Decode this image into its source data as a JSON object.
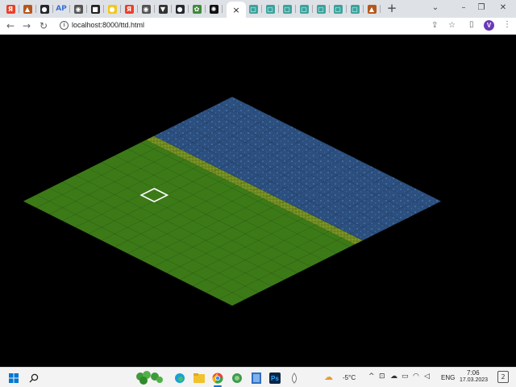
{
  "browser": {
    "tabs": [
      {
        "icon": "yandex-icon",
        "glyph": "Я",
        "color": "#e8402a"
      },
      {
        "icon": "game-castle-icon",
        "glyph": "▲",
        "color": "#b5571b"
      },
      {
        "icon": "github-icon",
        "glyph": "●",
        "color": "#24292e"
      },
      {
        "icon": "ap-icon",
        "glyph": "AP",
        "color": "#3b6fd4"
      },
      {
        "icon": "globe-icon",
        "glyph": "◉",
        "color": "#555555"
      },
      {
        "icon": "terminal-icon",
        "glyph": "■",
        "color": "#222222"
      },
      {
        "icon": "yellow-app-icon",
        "glyph": "●",
        "color": "#f2c81c"
      },
      {
        "icon": "yandex-icon",
        "glyph": "Я",
        "color": "#e8402a"
      },
      {
        "icon": "globe-icon",
        "glyph": "◉",
        "color": "#555555"
      },
      {
        "icon": "graduation-cap-icon",
        "glyph": "▼",
        "color": "#333333"
      },
      {
        "icon": "github-icon",
        "glyph": "●",
        "color": "#24292e"
      },
      {
        "icon": "green-app-icon",
        "glyph": "✿",
        "color": "#3f8a3a"
      },
      {
        "icon": "chatgpt-icon",
        "glyph": "✺",
        "color": "#111111"
      },
      {
        "icon": "page-icon",
        "glyph": "▢",
        "color": "#3aa39c"
      },
      {
        "icon": "page-icon",
        "glyph": "▢",
        "color": "#3aa39c"
      },
      {
        "icon": "page-icon",
        "glyph": "▢",
        "color": "#3aa39c"
      },
      {
        "icon": "page-icon",
        "glyph": "▢",
        "color": "#3aa39c"
      },
      {
        "icon": "page-icon",
        "glyph": "▢",
        "color": "#3aa39c"
      },
      {
        "icon": "page-icon",
        "glyph": "▢",
        "color": "#3aa39c"
      },
      {
        "icon": "page-icon",
        "glyph": "▢",
        "color": "#3aa39c"
      },
      {
        "icon": "game-castle-icon",
        "glyph": "▲",
        "color": "#b5571b"
      }
    ],
    "active_tab_close": "×",
    "new_tab": "+",
    "window_controls": {
      "dropdown": "⌄",
      "minimize": "–",
      "restore": "❐",
      "close": "✕"
    },
    "address": {
      "url": "localhost:8000/ttd.html",
      "info": "i"
    },
    "nav": {
      "back": "←",
      "forward": "→",
      "reload": "↻"
    },
    "omni_icons": {
      "share": "⇪",
      "bookmark": "☆",
      "sidebar": "▯"
    },
    "profile_initial": "V",
    "menu": "⋮"
  },
  "game": {
    "colors": {
      "grass": "#3c7a18",
      "grass_line": "#2e6612",
      "water": "#2b4f7f",
      "water_line": "#22416c",
      "shore": "#6f8a1f",
      "selector": "#ffffff"
    },
    "grid": {
      "cols": 16,
      "rows": 16
    },
    "water_rows": 6,
    "shore_row": 6,
    "selected_tile": {
      "col": 4,
      "row": 10
    }
  },
  "taskbar": {
    "weather": "-5°C",
    "language": "ENG",
    "time": "7:06",
    "date": "17.03.2023",
    "notifications": "2",
    "pinned": [
      {
        "icon": "start-icon"
      },
      {
        "icon": "search-icon"
      },
      {
        "icon": "clover-icon"
      },
      {
        "icon": "edge-icon"
      },
      {
        "icon": "file-explorer-icon"
      },
      {
        "icon": "chrome-icon"
      },
      {
        "icon": "green-globe-icon"
      },
      {
        "icon": "film-icon"
      },
      {
        "icon": "photoshop-icon"
      },
      {
        "icon": "drop-icon"
      }
    ]
  }
}
